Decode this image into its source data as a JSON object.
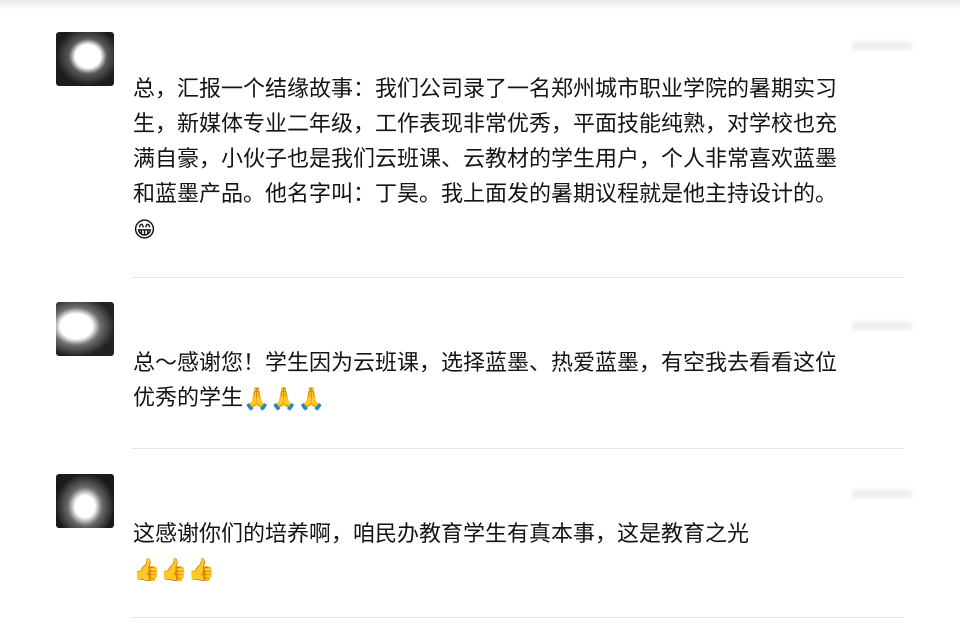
{
  "comments": [
    {
      "nickname": "",
      "text": "总，汇报一个结缘故事：我们公司录了一名郑州城市职业学院的暑期实习生，新媒体专业二年级，工作表现非常优秀，平面技能纯熟，对学校也充满自豪，小伙子也是我们云班课、云教材的学生用户，个人非常喜欢蓝墨和蓝墨产品。他名字叫：丁昊。我上面发的暑期议程就是他主持设计的。",
      "emoji": "😁"
    },
    {
      "nickname": "",
      "text": "总～感谢您！学生因为云班课，选择蓝墨、热爱蓝墨，有空我去看看这位优秀的学生",
      "emoji": "🙏🙏🙏"
    },
    {
      "nickname": "",
      "text": "这感谢你们的培养啊，咱民办教育学生有真本事，这是教育之光",
      "emoji": "👍👍👍"
    }
  ]
}
